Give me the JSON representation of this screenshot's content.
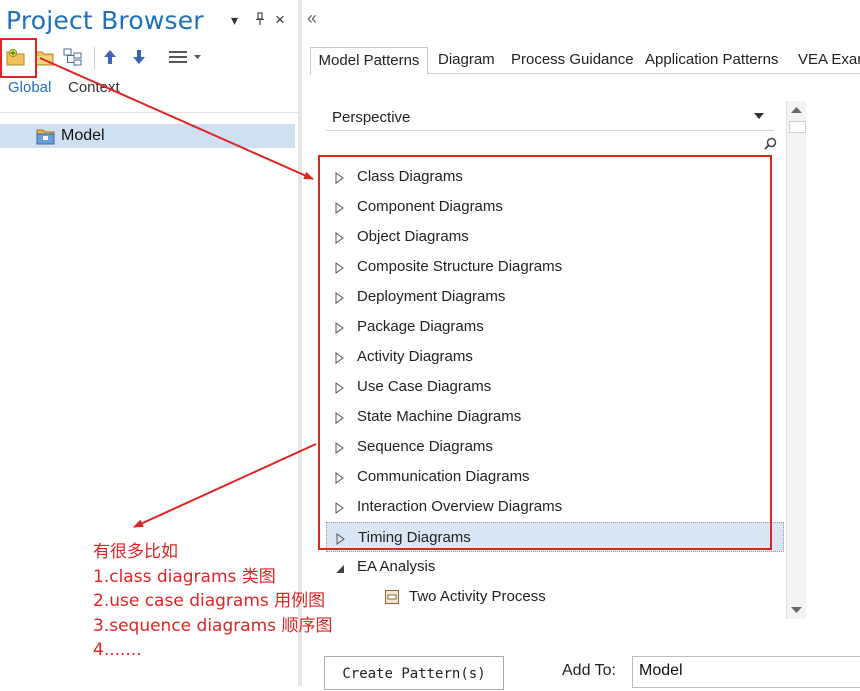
{
  "project_browser": {
    "title": "Project Browser",
    "controls": {
      "dropdown": "▾",
      "pin": "†",
      "close": "×"
    },
    "toolbar_icons": [
      "new-model-icon",
      "folder-icon",
      "hierarchy-icon",
      "move-up-icon",
      "move-down-icon",
      "menu-icon"
    ],
    "tabs": [
      "Global",
      "Context"
    ],
    "tree": [
      {
        "label": "Model",
        "icon": "package-icon"
      }
    ]
  },
  "collapse_symbol": "«",
  "tabs": [
    "Model Patterns",
    "Diagram",
    "Process Guidance",
    "Application Patterns",
    "VEA Exam"
  ],
  "perspective": {
    "label": "Perspective"
  },
  "patterns": {
    "items": [
      "Class Diagrams",
      "Component Diagrams",
      "Object Diagrams",
      "Composite Structure Diagrams",
      "Deployment Diagrams",
      "Package Diagrams",
      "Activity Diagrams",
      "Use Case Diagrams",
      "State Machine Diagrams",
      "Sequence Diagrams",
      "Communication Diagrams",
      "Interaction Overview Diagrams",
      "Timing Diagrams"
    ],
    "selected": "Timing Diagrams",
    "ea_analysis": {
      "label": "EA Analysis",
      "child": "Two Activity Process"
    }
  },
  "annotation": {
    "lines": [
      "有很多比如",
      "1.class diagrams 类图",
      "2.use case diagrams 用例图",
      "3.sequence diagrams 顺序图",
      "4......."
    ],
    "color": "#e02424"
  },
  "footer": {
    "create_button": "Create Pattern(s)",
    "add_to_label": "Add To:",
    "add_to_value": "Model"
  },
  "colors": {
    "accent": "#1e6fbf",
    "selection": "#cfe0f3",
    "annotation_red": "#e02424"
  }
}
